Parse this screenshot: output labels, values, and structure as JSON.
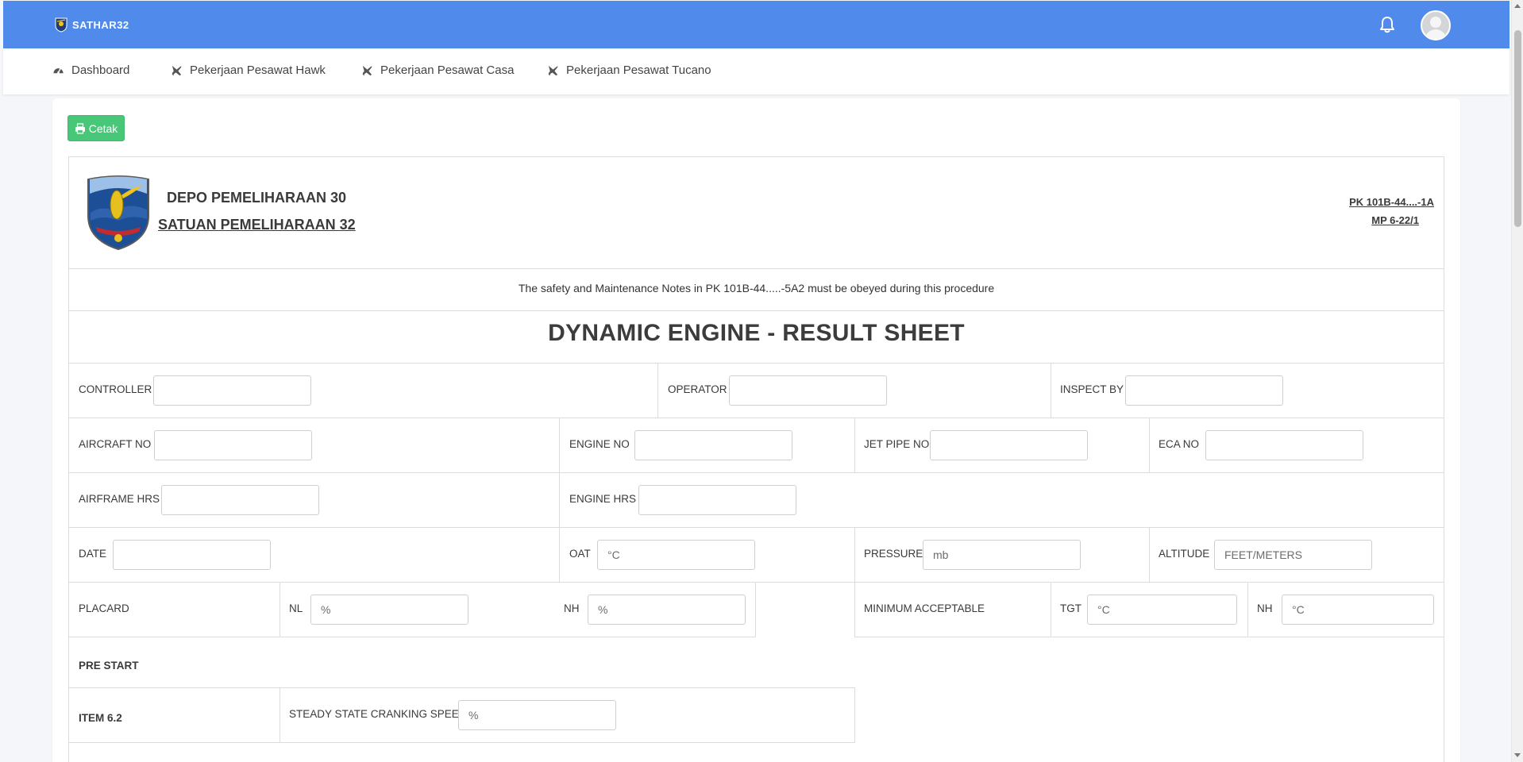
{
  "app": {
    "brand": "SATHAR32",
    "brand_icon": "shield-emblem-icon",
    "notification_icon": "bell-icon",
    "accent_color": "#508aea"
  },
  "nav": {
    "items": [
      {
        "label": "Dashboard",
        "icon": "dashboard-gauge-icon"
      },
      {
        "label": "Pekerjaan Pesawat Hawk",
        "icon": "plane-icon"
      },
      {
        "label": "Pekerjaan Pesawat Casa",
        "icon": "plane-icon"
      },
      {
        "label": "Pekerjaan Pesawat Tucano",
        "icon": "plane-icon"
      }
    ]
  },
  "actions": {
    "print_label": "Cetak",
    "print_icon": "printer-icon",
    "print_color": "#48c779"
  },
  "sheet": {
    "org_line1": "DEPO PEMELIHARAAN 30",
    "org_line2": "SATUAN PEMELIHARAAN 32",
    "ref_line1": "PK 101B-44....-1A",
    "ref_line2": "MP 6-22/1",
    "note": "The safety and Maintenance Notes in PK 101B-44.....-5A2 must be obeyed during this procedure",
    "title": "DYNAMIC ENGINE - RESULT SHEET"
  },
  "fields": {
    "controller": {
      "label": "CONTROLLER",
      "value": "",
      "placeholder": ""
    },
    "operator": {
      "label": "OPERATOR",
      "value": "",
      "placeholder": ""
    },
    "inspect_by": {
      "label": "INSPECT BY",
      "value": "",
      "placeholder": ""
    },
    "aircraft_no": {
      "label": "AIRCRAFT NO",
      "value": "",
      "placeholder": ""
    },
    "engine_no": {
      "label": "ENGINE NO",
      "value": "",
      "placeholder": ""
    },
    "jet_pipe_no": {
      "label": "JET PIPE NO",
      "value": "",
      "placeholder": ""
    },
    "eca_no": {
      "label": "ECA NO",
      "value": "",
      "placeholder": ""
    },
    "airframe_hrs": {
      "label": "AIRFRAME HRS",
      "value": "",
      "placeholder": ""
    },
    "engine_hrs": {
      "label": "ENGINE HRS",
      "value": "",
      "placeholder": ""
    },
    "date": {
      "label": "DATE",
      "value": "",
      "placeholder": ""
    },
    "oat": {
      "label": "OAT",
      "value": "",
      "placeholder": "°C"
    },
    "pressure": {
      "label": "PRESSURE",
      "value": "",
      "placeholder": "mb"
    },
    "altitude": {
      "label": "ALTITUDE",
      "value": "",
      "placeholder": "FEET/METERS"
    },
    "placard": {
      "label": "PLACARD"
    },
    "placard_nl": {
      "label": "NL",
      "value": "",
      "placeholder": "%"
    },
    "placard_nh": {
      "label": "NH",
      "value": "",
      "placeholder": "%"
    },
    "minimum_acceptable": {
      "label": "MINIMUM ACCEPTABLE"
    },
    "min_tgt": {
      "label": "TGT",
      "value": "",
      "placeholder": "°C"
    },
    "min_nh": {
      "label": "NH",
      "value": "",
      "placeholder": "°C"
    }
  },
  "sections": {
    "pre_start": "PRE START",
    "item_62": {
      "item_label": "ITEM 6.2",
      "label": "STEADY STATE CRANKING SPEED",
      "value": "",
      "placeholder": "%"
    }
  }
}
